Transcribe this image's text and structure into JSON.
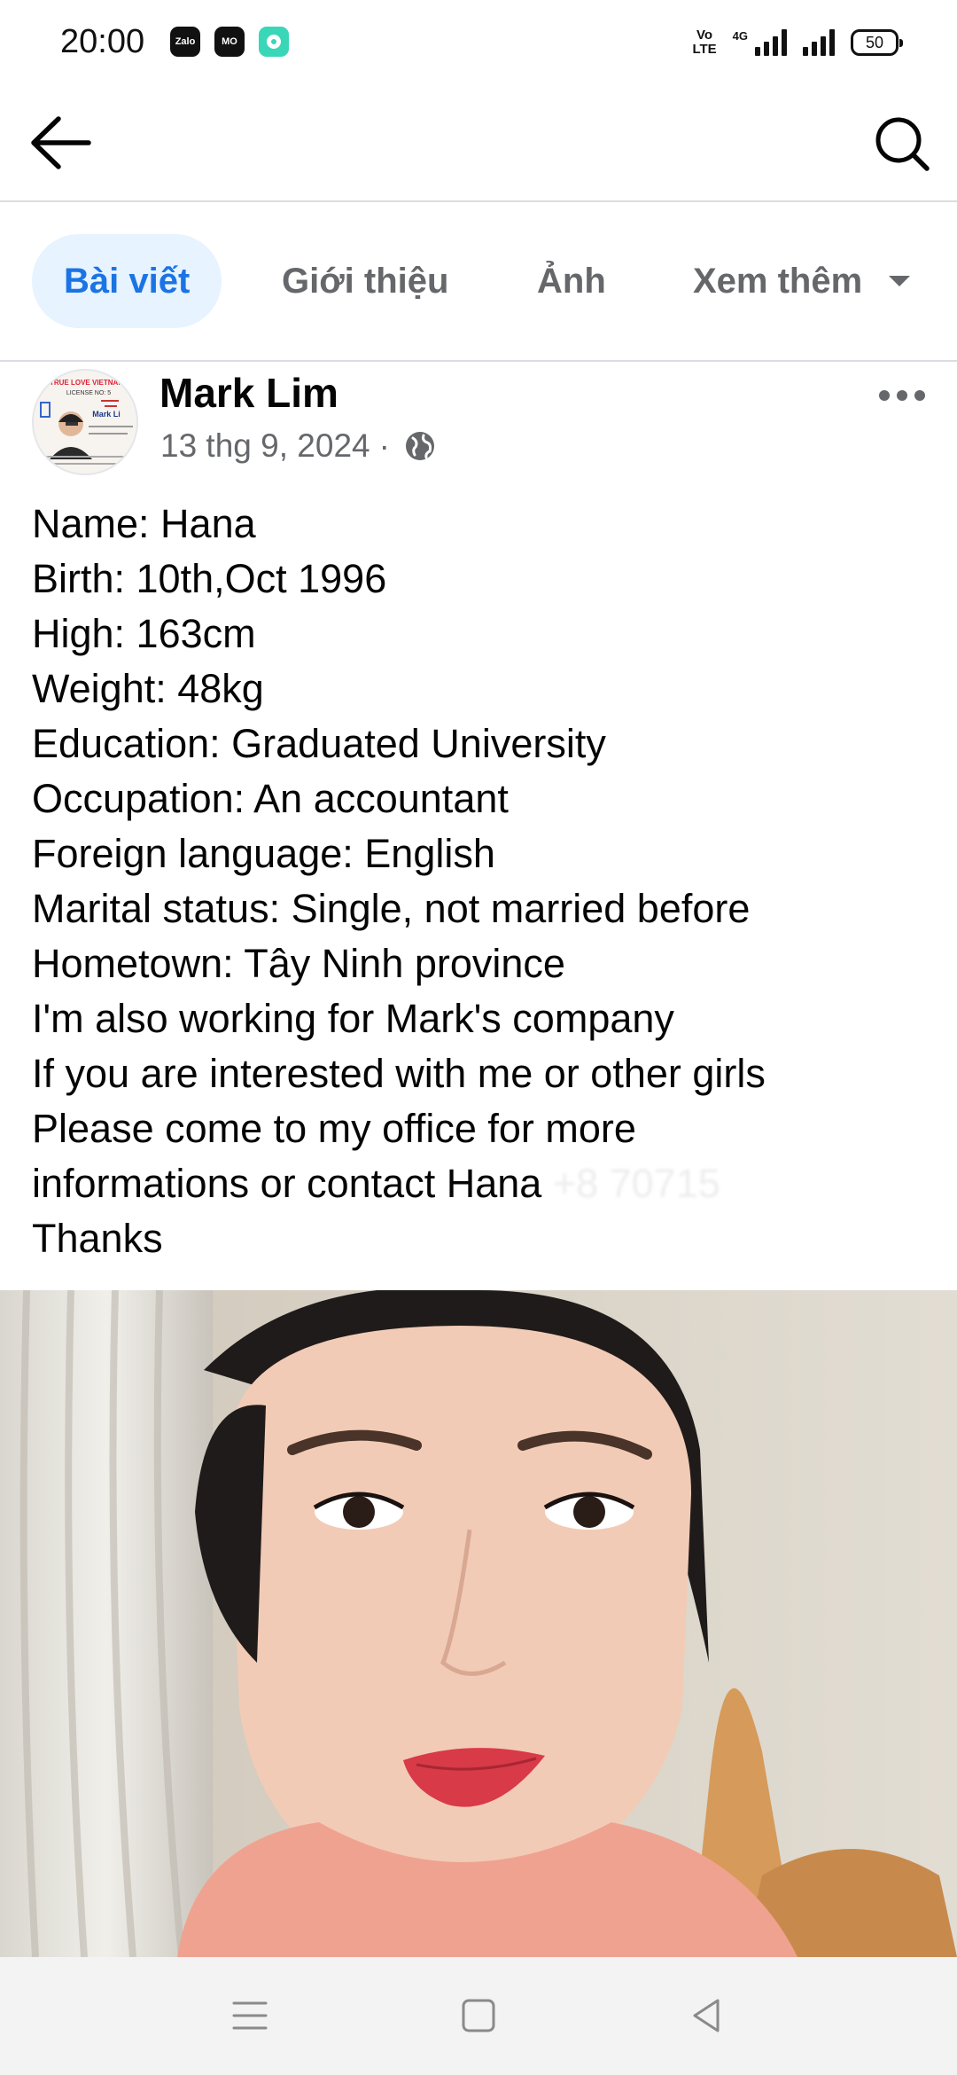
{
  "status_bar": {
    "time": "20:00",
    "apps": [
      "Zalo",
      "MO",
      ""
    ],
    "volte": "Vo LTE",
    "network": "4G",
    "battery": "50"
  },
  "header": {
    "back_icon": "arrow-left-icon",
    "search_icon": "search-icon"
  },
  "tabs": [
    {
      "label": "Bài viết",
      "active": true
    },
    {
      "label": "Giới thiệu",
      "active": false
    },
    {
      "label": "Ảnh",
      "active": false
    },
    {
      "label": "Xem thêm",
      "active": false
    }
  ],
  "post": {
    "author": "Mark Lim",
    "date": "13 thg 9, 2024",
    "separator": "·",
    "privacy_icon": "globe-icon",
    "avatar_text": [
      "TRUE LOVE VIETNAM",
      "LICENSE NO: 5",
      "Mark Li"
    ],
    "lines": [
      "Name: Hana",
      "Birth: 10th,Oct 1996",
      "High: 163cm",
      "Weight: 48kg",
      "Education: Graduated University",
      "Occupation: An accountant",
      "Foreign language: English",
      "Marital status: Single, not married before",
      "Hometown: Tây Ninh province",
      "I'm also working for Mark's company",
      "If you are interested with me or other girls",
      "Please come to my office for more",
      "informations or contact Hana"
    ],
    "phone_obscured": "+8 70715",
    "closing": "Thanks"
  },
  "colors": {
    "accent": "#1b74e4",
    "active_tab_bg": "#e7f3ff",
    "muted_text": "#65676b",
    "divider": "#dadde1"
  },
  "nav_bar": {
    "icons": [
      "menu-icon",
      "home-square-icon",
      "back-triangle-icon"
    ]
  }
}
